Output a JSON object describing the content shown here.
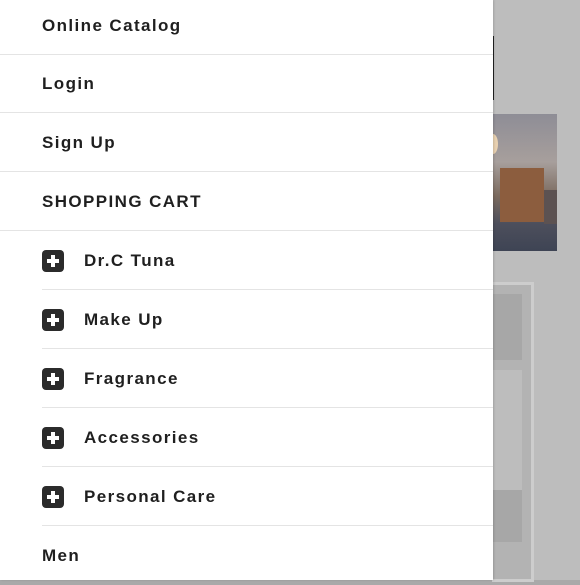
{
  "menu": {
    "top_items": [
      {
        "label": "Online Catalog"
      },
      {
        "label": "Login"
      },
      {
        "label": "Sign Up"
      },
      {
        "label": "SHOPPING CART"
      }
    ],
    "categories": [
      {
        "label": "Dr.C Tuna",
        "icon": "plus-icon"
      },
      {
        "label": "Make Up",
        "icon": "plus-icon"
      },
      {
        "label": "Fragrance",
        "icon": "plus-icon"
      },
      {
        "label": "Accessories",
        "icon": "plus-icon"
      },
      {
        "label": "Personal Care",
        "icon": "plus-icon"
      }
    ],
    "bottom_items": [
      {
        "label": "Men"
      }
    ]
  },
  "colors": {
    "menu_text": "#1f1f1f",
    "icon_bg": "#2b2b2b",
    "overlay": "#a9a9a9"
  }
}
